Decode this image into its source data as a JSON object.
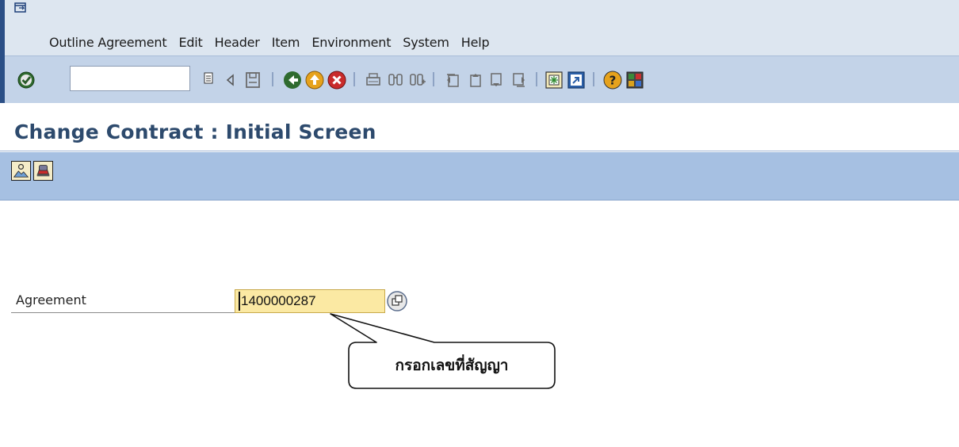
{
  "menu": {
    "items": [
      "Outline Agreement",
      "Edit",
      "Header",
      "Item",
      "Environment",
      "System",
      "Help"
    ]
  },
  "toolbar": {
    "command_value": "",
    "icons": [
      "enter-icon",
      "command-dropdown-icon",
      "back-arrow-icon",
      "save-icon",
      "back-icon",
      "exit-icon",
      "cancel-icon",
      "print-icon",
      "find-icon",
      "find-next-icon",
      "first-page-icon",
      "previous-page-icon",
      "next-page-icon",
      "last-page-icon",
      "new-session-icon",
      "shortcut-icon",
      "help-icon",
      "customize-layout-icon"
    ]
  },
  "page": {
    "title": "Change Contract : Initial Screen"
  },
  "app_toolbar": {
    "icons": [
      "reference-icon",
      "org-data-icon"
    ]
  },
  "form": {
    "agreement_label": "Agreement",
    "agreement_value": "1400000287"
  },
  "callout": {
    "text": "กรอกเลขที่สัญญา"
  },
  "colors": {
    "menu_bg": "#dde6f0",
    "toolbar_bg": "#c3d3e8",
    "app_toolbar_bg": "#a6c0e2",
    "title_color": "#2d4a6d",
    "field_bg": "#fbe9a3"
  }
}
